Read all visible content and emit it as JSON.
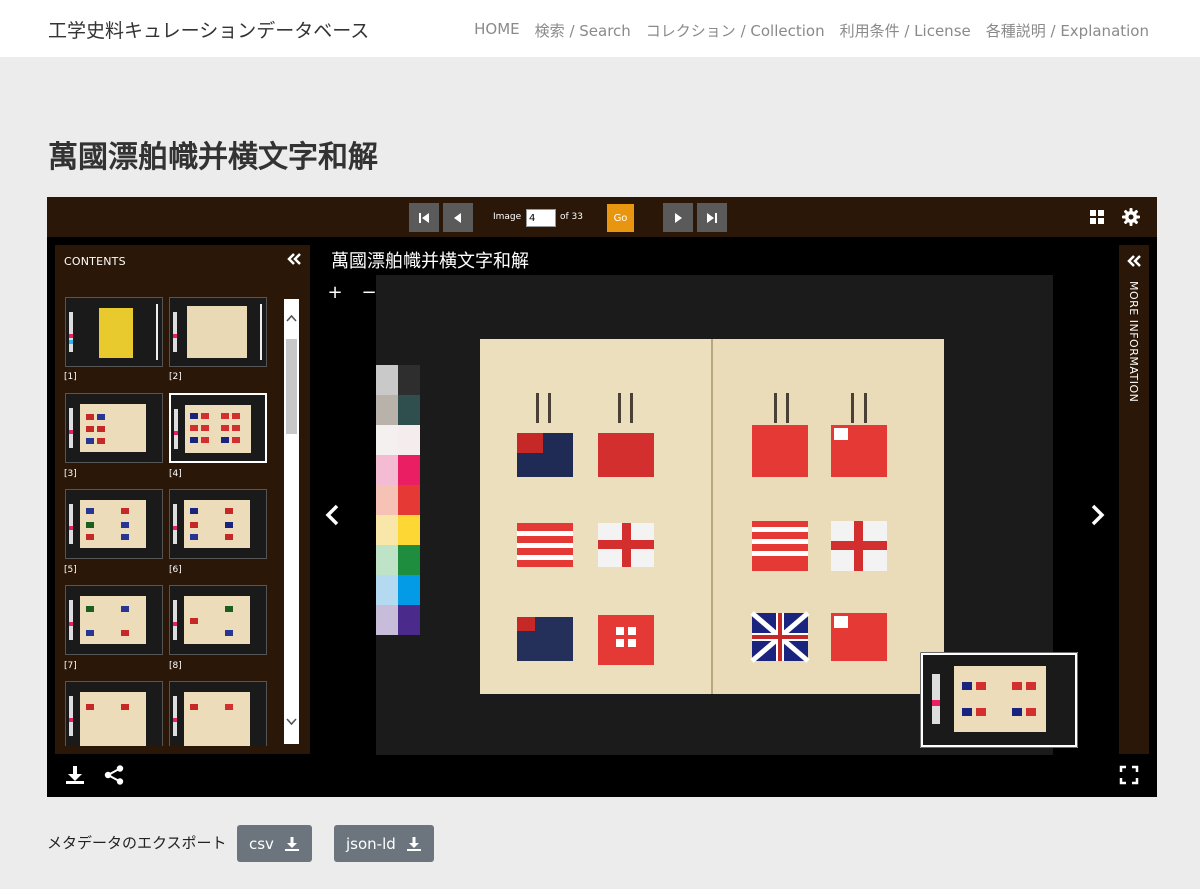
{
  "header": {
    "site_title": "工学史料キュレーションデータベース",
    "nav": [
      "HOME",
      "検索 / Search",
      "コレクション / Collection",
      "利用条件 / License",
      "各種説明 / Explanation"
    ]
  },
  "page": {
    "title": "萬國漂舶幟并横文字和解"
  },
  "viewer": {
    "image_label": "Image",
    "current_image": "4",
    "of_total": "of 33",
    "go_label": "Go",
    "contents_title": "CONTENTS",
    "canvas_title": "萬國漂舶幟并横文字和解",
    "more_info_label": "MORE INFORMATION",
    "zoom_in": "+",
    "zoom_out": "−",
    "thumbnails": [
      "[1]",
      "[2]",
      "[3]",
      "[4]",
      "[5]",
      "[6]",
      "[7]",
      "[8]"
    ],
    "active_thumbnail": "[4]"
  },
  "export": {
    "label": "メタデータのエクスポート",
    "buttons": [
      "csv",
      "json-ld"
    ]
  },
  "colors": {
    "viewer_bar": "#2a1707",
    "go_button": "#e8950f",
    "export_button": "#6c757d"
  }
}
